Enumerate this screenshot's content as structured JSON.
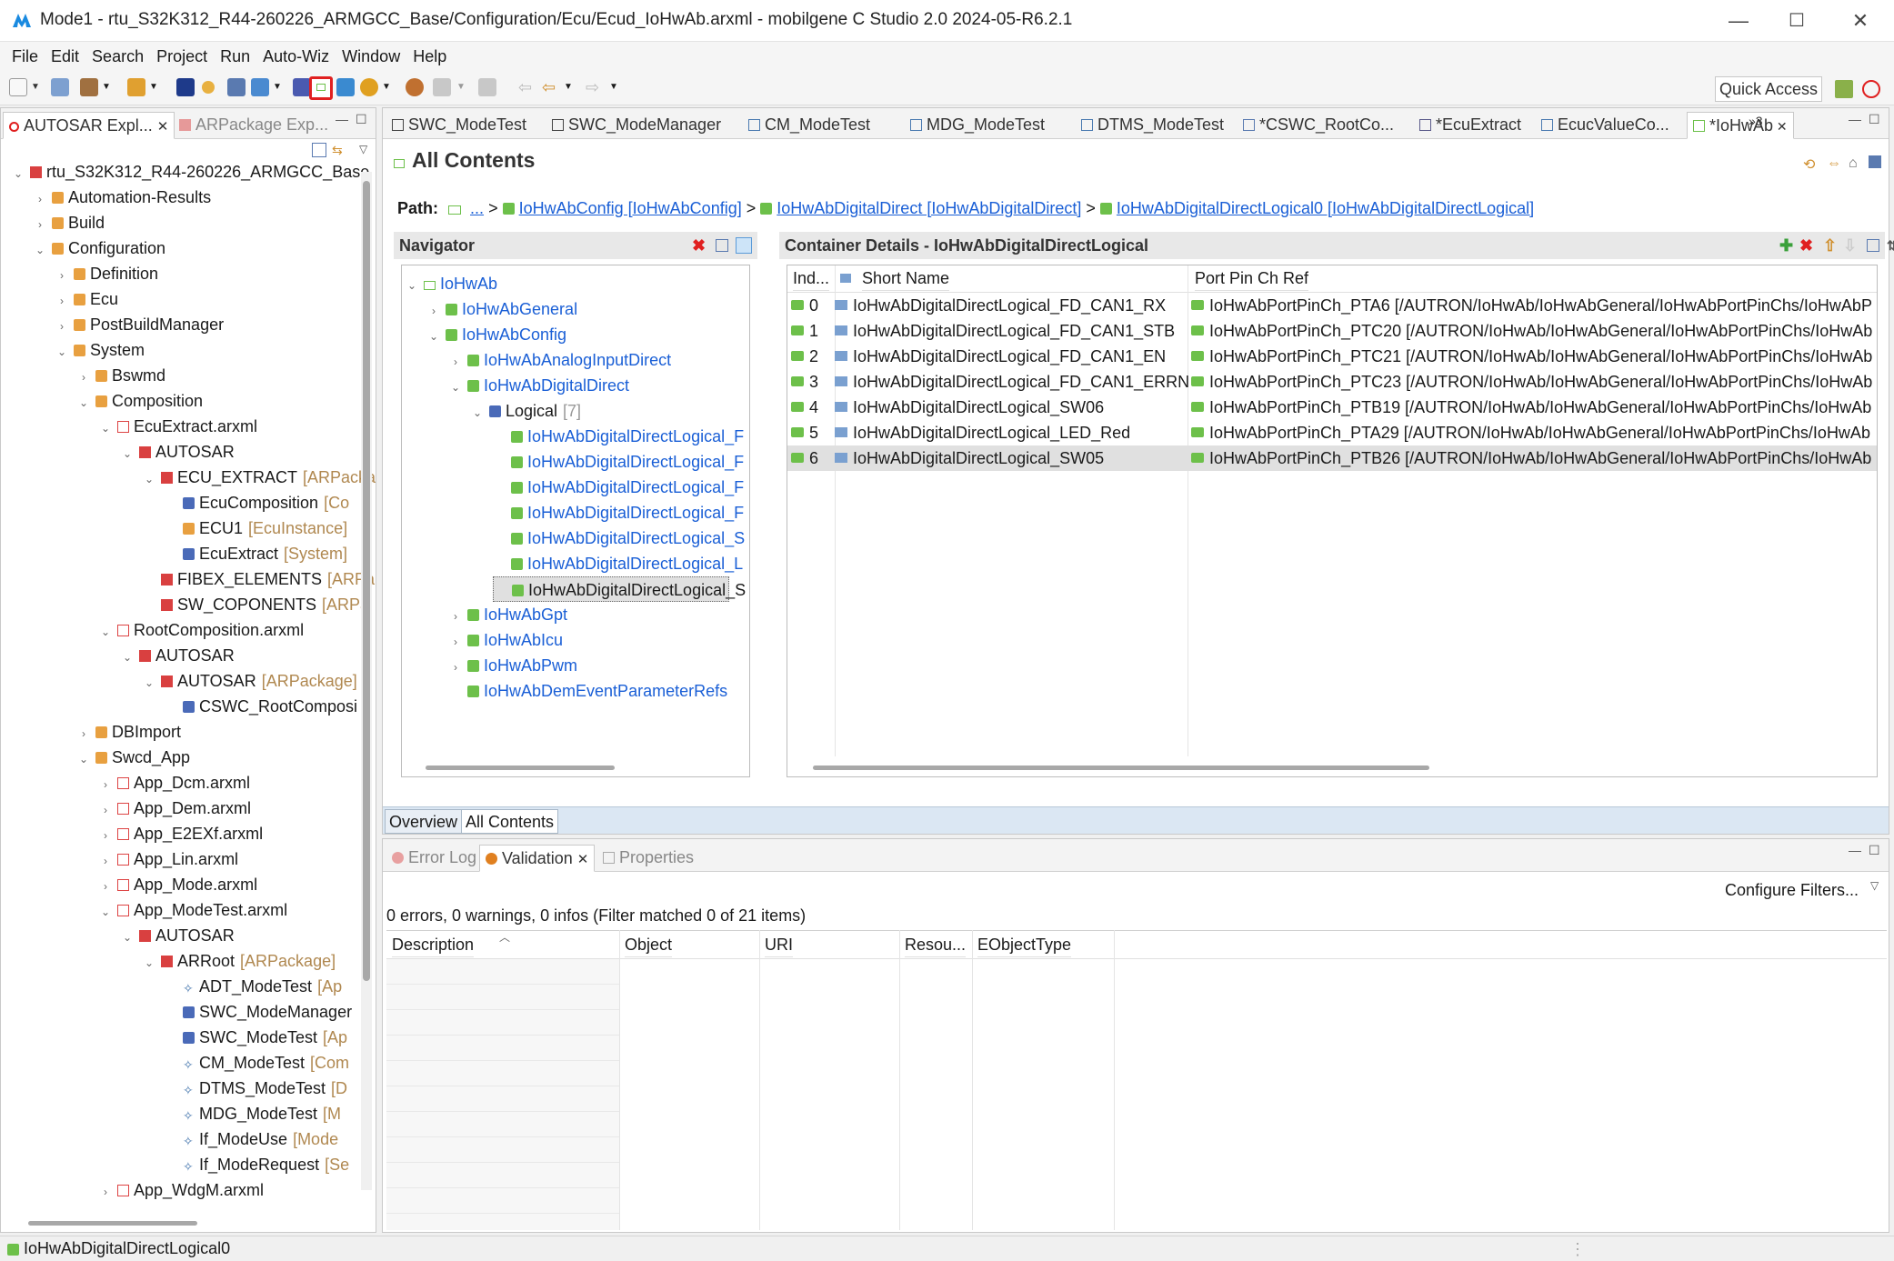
{
  "window": {
    "title": "Mode1 - rtu_S32K312_R44-260226_ARMGCC_Base/Configuration/Ecu/Ecud_IoHwAb.arxml - mobilgene C Studio 2.0 2024-05-R6.2.1",
    "minimize": "—",
    "maximize": "☐",
    "close": "✕"
  },
  "menu": [
    "File",
    "Edit",
    "Search",
    "Project",
    "Run",
    "Auto-Wiz",
    "Window",
    "Help"
  ],
  "quick_access": "Quick Access",
  "left_panel": {
    "tabs": [
      "AUTOSAR Expl...",
      "ARPackage Exp..."
    ],
    "tree": [
      {
        "d": 0,
        "t": "rtu_S32K312_R44-260226_ARMGCC_Base",
        "m": "",
        "ic": "redpkg",
        "e": "v"
      },
      {
        "d": 1,
        "t": "Automation-Results",
        "m": "",
        "ic": "fold",
        "e": ">"
      },
      {
        "d": 1,
        "t": "Build",
        "m": "",
        "ic": "fold",
        "e": ">"
      },
      {
        "d": 1,
        "t": "Configuration",
        "m": "",
        "ic": "fold",
        "e": "v"
      },
      {
        "d": 2,
        "t": "Definition",
        "m": "",
        "ic": "fold",
        "e": ">"
      },
      {
        "d": 2,
        "t": "Ecu",
        "m": "",
        "ic": "fold",
        "e": ">"
      },
      {
        "d": 2,
        "t": "PostBuildManager",
        "m": "",
        "ic": "fold",
        "e": ">"
      },
      {
        "d": 2,
        "t": "System",
        "m": "",
        "ic": "fold",
        "e": "v"
      },
      {
        "d": 3,
        "t": "Bswmd",
        "m": "",
        "ic": "fold",
        "e": ">"
      },
      {
        "d": 3,
        "t": "Composition",
        "m": "",
        "ic": "fold",
        "e": "v"
      },
      {
        "d": 4,
        "t": "EcuExtract.arxml",
        "m": "",
        "ic": "file",
        "e": "v"
      },
      {
        "d": 5,
        "t": "AUTOSAR",
        "m": "",
        "ic": "redpkg",
        "e": "v"
      },
      {
        "d": 6,
        "t": "ECU_EXTRACT",
        "m": "[ARPacka",
        "ic": "redpkg",
        "e": "v"
      },
      {
        "d": 7,
        "t": "EcuComposition",
        "m": "[Co",
        "ic": "bfold",
        "e": ""
      },
      {
        "d": 7,
        "t": "ECU1",
        "m": "[EcuInstance]",
        "ic": "fold",
        "e": ""
      },
      {
        "d": 7,
        "t": "EcuExtract",
        "m": "[System]",
        "ic": "bfold",
        "e": ""
      },
      {
        "d": 6,
        "t": "FIBEX_ELEMENTS",
        "m": "[ARPa",
        "ic": "redpkg",
        "e": ""
      },
      {
        "d": 6,
        "t": "SW_COPONENTS",
        "m": "[ARPa",
        "ic": "redpkg",
        "e": ""
      },
      {
        "d": 4,
        "t": "RootComposition.arxml",
        "m": "",
        "ic": "file",
        "e": "v"
      },
      {
        "d": 5,
        "t": "AUTOSAR",
        "m": "",
        "ic": "redpkg",
        "e": "v"
      },
      {
        "d": 6,
        "t": "AUTOSAR",
        "m": "[ARPackage]",
        "ic": "redpkg",
        "e": "v"
      },
      {
        "d": 7,
        "t": "CSWC_RootComposi",
        "m": "",
        "ic": "bfold",
        "e": ""
      },
      {
        "d": 3,
        "t": "DBImport",
        "m": "",
        "ic": "fold",
        "e": ">"
      },
      {
        "d": 3,
        "t": "Swcd_App",
        "m": "",
        "ic": "fold",
        "e": "v"
      },
      {
        "d": 4,
        "t": "App_Dcm.arxml",
        "m": "",
        "ic": "file",
        "e": ">"
      },
      {
        "d": 4,
        "t": "App_Dem.arxml",
        "m": "",
        "ic": "file",
        "e": ">"
      },
      {
        "d": 4,
        "t": "App_E2EXf.arxml",
        "m": "",
        "ic": "file",
        "e": ">"
      },
      {
        "d": 4,
        "t": "App_Lin.arxml",
        "m": "",
        "ic": "file",
        "e": ">"
      },
      {
        "d": 4,
        "t": "App_Mode.arxml",
        "m": "",
        "ic": "file",
        "e": ">"
      },
      {
        "d": 4,
        "t": "App_ModeTest.arxml",
        "m": "",
        "ic": "file",
        "e": "v"
      },
      {
        "d": 5,
        "t": "AUTOSAR",
        "m": "",
        "ic": "redpkg",
        "e": "v"
      },
      {
        "d": 6,
        "t": "ARRoot",
        "m": "[ARPackage]",
        "ic": "redpkg",
        "e": "v"
      },
      {
        "d": 7,
        "t": "ADT_ModeTest",
        "m": "[Ap",
        "ic": "none",
        "e": ""
      },
      {
        "d": 7,
        "t": "SWC_ModeManager",
        "m": "",
        "ic": "bfold",
        "e": ""
      },
      {
        "d": 7,
        "t": "SWC_ModeTest",
        "m": "[Ap",
        "ic": "bfold",
        "e": ""
      },
      {
        "d": 7,
        "t": "CM_ModeTest",
        "m": "[Com",
        "ic": "none",
        "e": ""
      },
      {
        "d": 7,
        "t": "DTMS_ModeTest",
        "m": "[D",
        "ic": "none",
        "e": ""
      },
      {
        "d": 7,
        "t": "MDG_ModeTest",
        "m": "[M",
        "ic": "none",
        "e": ""
      },
      {
        "d": 7,
        "t": "If_ModeUse",
        "m": "[Mode",
        "ic": "none",
        "e": ""
      },
      {
        "d": 7,
        "t": "If_ModeRequest",
        "m": "[Se",
        "ic": "none",
        "e": ""
      },
      {
        "d": 4,
        "t": "App_WdgM.arxml",
        "m": "",
        "ic": "file",
        "e": ">"
      }
    ]
  },
  "editor_tabs": [
    "SWC_ModeTest",
    "SWC_ModeManager",
    "CM_ModeTest",
    "MDG_ModeTest",
    "DTMS_ModeTest",
    "*CSWC_RootCo...",
    "*EcuExtract",
    "EcucValueCo...",
    "*IoHwAb"
  ],
  "editor_tabs_overflow": "»3",
  "page_title": "All Contents",
  "path": {
    "label": "Path:",
    "dots": "...",
    "seg1": "IoHwAbConfig [IoHwAbConfig]",
    "seg2": "IoHwAbDigitalDirect [IoHwAbDigitalDirect]",
    "seg3": "IoHwAbDigitalDirectLogical0 [IoHwAbDigitalDirectLogical]",
    "sep": ">"
  },
  "navigator": {
    "title": "Navigator",
    "tree": [
      {
        "d": 0,
        "t": "IoHwAb",
        "e": "v",
        "ic": "white"
      },
      {
        "d": 1,
        "t": "IoHwAbGeneral",
        "e": ">",
        "ic": "gfold"
      },
      {
        "d": 1,
        "t": "IoHwAbConfig",
        "e": "v",
        "ic": "gfold"
      },
      {
        "d": 2,
        "t": "IoHwAbAnalogInputDirect",
        "e": ">",
        "ic": "gfold"
      },
      {
        "d": 2,
        "t": "IoHwAbDigitalDirect",
        "e": "v",
        "ic": "gfold"
      },
      {
        "d": 3,
        "t": "Logical",
        "m": "[7]",
        "e": "v",
        "ic": "bfold",
        "plain": true
      },
      {
        "d": 4,
        "t": "IoHwAbDigitalDirectLogical_F",
        "e": "",
        "ic": "gfold"
      },
      {
        "d": 4,
        "t": "IoHwAbDigitalDirectLogical_F",
        "e": "",
        "ic": "gfold"
      },
      {
        "d": 4,
        "t": "IoHwAbDigitalDirectLogical_F",
        "e": "",
        "ic": "gfold"
      },
      {
        "d": 4,
        "t": "IoHwAbDigitalDirectLogical_F",
        "e": "",
        "ic": "gfold"
      },
      {
        "d": 4,
        "t": "IoHwAbDigitalDirectLogical_S",
        "e": "",
        "ic": "gfold"
      },
      {
        "d": 4,
        "t": "IoHwAbDigitalDirectLogical_L",
        "e": "",
        "ic": "gfold"
      },
      {
        "d": 4,
        "t": "IoHwAbDigitalDirectLogical_S",
        "e": "",
        "ic": "gfold",
        "sel": true,
        "plain": true
      },
      {
        "d": 2,
        "t": "IoHwAbGpt",
        "e": ">",
        "ic": "gfold"
      },
      {
        "d": 2,
        "t": "IoHwAbIcu",
        "e": ">",
        "ic": "gfold"
      },
      {
        "d": 2,
        "t": "IoHwAbPwm",
        "e": ">",
        "ic": "gfold"
      },
      {
        "d": 2,
        "t": "IoHwAbDemEventParameterRefs",
        "e": "",
        "ic": "gfold"
      }
    ]
  },
  "details": {
    "title": "Container Details - IoHwAbDigitalDirectLogical",
    "columns": [
      "Ind...",
      "Short Name",
      "Port Pin Ch Ref"
    ],
    "rows": [
      [
        "0",
        "IoHwAbDigitalDirectLogical_FD_CAN1_RX",
        "IoHwAbPortPinCh_PTA6 [/AUTRON/IoHwAb/IoHwAbGeneral/IoHwAbPortPinChs/IoHwAbP"
      ],
      [
        "1",
        "IoHwAbDigitalDirectLogical_FD_CAN1_STB",
        "IoHwAbPortPinCh_PTC20 [/AUTRON/IoHwAb/IoHwAbGeneral/IoHwAbPortPinChs/IoHwAb"
      ],
      [
        "2",
        "IoHwAbDigitalDirectLogical_FD_CAN1_EN",
        "IoHwAbPortPinCh_PTC21 [/AUTRON/IoHwAb/IoHwAbGeneral/IoHwAbPortPinChs/IoHwAb"
      ],
      [
        "3",
        "IoHwAbDigitalDirectLogical_FD_CAN1_ERRN",
        "IoHwAbPortPinCh_PTC23 [/AUTRON/IoHwAb/IoHwAbGeneral/IoHwAbPortPinChs/IoHwAb"
      ],
      [
        "4",
        "IoHwAbDigitalDirectLogical_SW06",
        "IoHwAbPortPinCh_PTB19 [/AUTRON/IoHwAb/IoHwAbGeneral/IoHwAbPortPinChs/IoHwAb"
      ],
      [
        "5",
        "IoHwAbDigitalDirectLogical_LED_Red",
        "IoHwAbPortPinCh_PTA29 [/AUTRON/IoHwAb/IoHwAbGeneral/IoHwAbPortPinChs/IoHwAb"
      ],
      [
        "6",
        "IoHwAbDigitalDirectLogical_SW05",
        "IoHwAbPortPinCh_PTB26 [/AUTRON/IoHwAb/IoHwAbGeneral/IoHwAbPortPinChs/IoHwAb"
      ]
    ]
  },
  "page_tabs": [
    "Overview",
    "All Contents"
  ],
  "bottom": {
    "tabs": [
      "Error Log",
      "Validation",
      "Properties"
    ],
    "summary": "0 errors, 0 warnings, 0 infos (Filter matched 0 of 21 items)",
    "configure": "Configure Filters...",
    "columns": [
      "Description",
      "Object",
      "URI",
      "Resou...",
      "EObjectType"
    ]
  },
  "status": "IoHwAbDigitalDirectLogical0",
  "colors": {
    "accent": "#1a5fd6",
    "highlight": "#e02020",
    "selection": "#e0e0e0"
  }
}
